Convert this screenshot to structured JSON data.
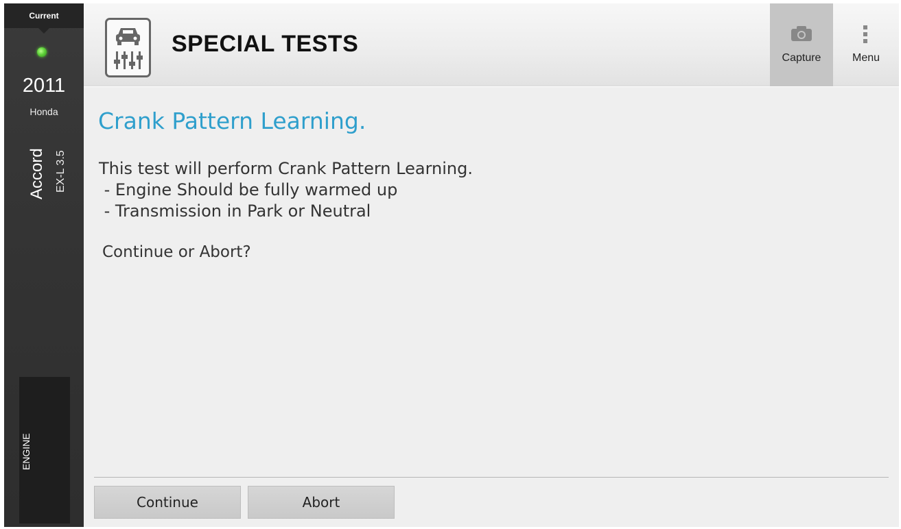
{
  "sidebar": {
    "current_label": "Current",
    "vehicle": {
      "year": "2011",
      "make": "Honda",
      "model": "Accord",
      "trim": "EX-L 3.5"
    },
    "module": "ENGINE",
    "status_color": "#5fd13a"
  },
  "header": {
    "title": "SPECIAL TESTS",
    "icon": "car-diagnostics-icon",
    "capture_label": "Capture",
    "menu_label": "Menu"
  },
  "content": {
    "step_title": "Crank Pattern Learning.",
    "description_lines": [
      "This test will perform Crank Pattern Learning.",
      " - Engine Should be fully warmed up",
      " - Transmission in Park or Neutral"
    ],
    "prompt": "Continue or Abort?"
  },
  "actions": {
    "continue_label": "Continue",
    "abort_label": "Abort"
  },
  "colors": {
    "accent": "#2f9fcc",
    "sidebar_bg": "#333333",
    "header_active_bg": "#c5c5c5"
  }
}
